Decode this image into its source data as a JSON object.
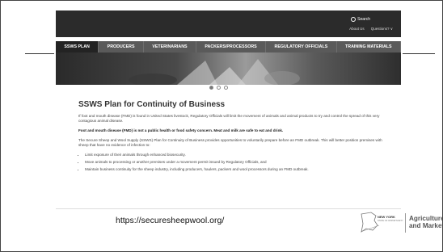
{
  "header": {
    "search_label": "Search",
    "about": "About Us",
    "questions": "Questions? ∨"
  },
  "nav": {
    "items": [
      {
        "label": "SSWS PLAN"
      },
      {
        "label": "PRODUCERS"
      },
      {
        "label": "VETERINARIANS"
      },
      {
        "label": "PACKERS/PROCESSORS"
      },
      {
        "label": "REGULATORY OFFICIALS"
      },
      {
        "label": "TRAINING MATERIALS"
      }
    ]
  },
  "main": {
    "title": "SSWS Plan for Continuity of Business",
    "p1": "If foot and mouth disease (FMD) is found in United States livestock, Regulatory Officials will limit the movement of animals and animal products to try and control the spread of this very contagious animal disease.",
    "p2": "Foot and mouth disease (FMD) is not a public health or food safety concern. Meat and milk are safe to eat and drink.",
    "p3": "The Secure Sheep and Wool Supply (SSWS) Plan for Continuity of Business provides opportunities to voluntarily prepare before an FMD outbreak. This will better position premises with sheep that have no evidence of infection to:",
    "bullets": [
      "Limit exposure of their animals through enhanced biosecurity.",
      "Move animals to processing or another premises under a movement permit issued by Regulatory Officials, and",
      "Maintain business continuity for the sheep industry, including producers, haulers, packers and wool processors during an FMD outbreak."
    ]
  },
  "footer": {
    "url": "https://securesheepwool.org/",
    "ny_logo": "NEW YORK",
    "ny_sub": "STATE OF OPPORTUNITY",
    "agency_line1": "Agriculture",
    "agency_line2": "and Markets"
  }
}
